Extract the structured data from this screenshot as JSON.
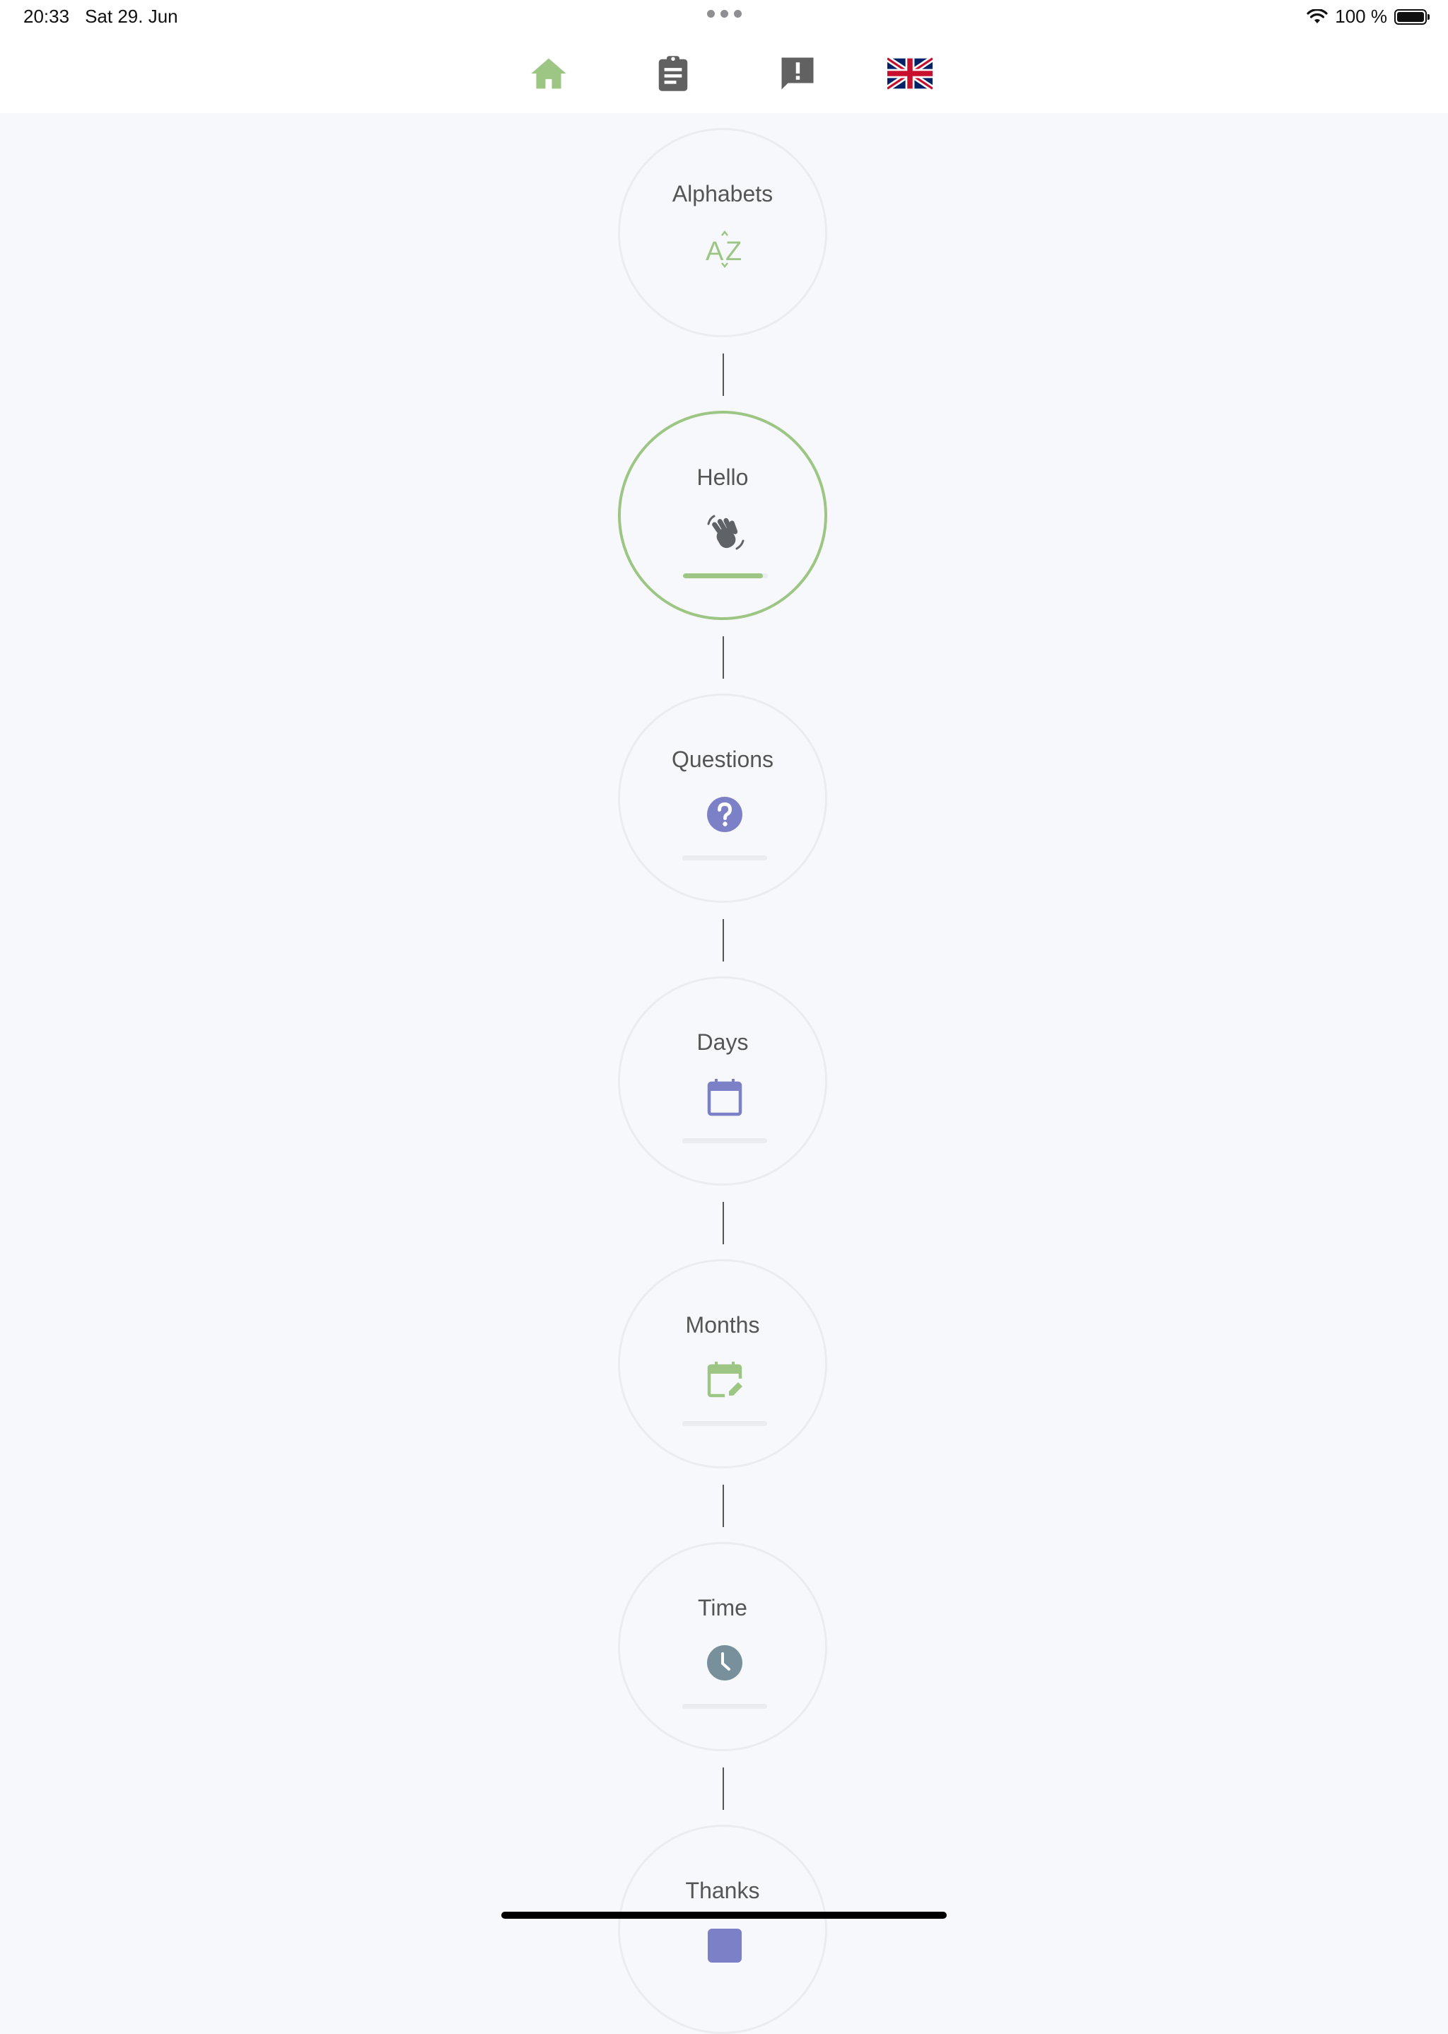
{
  "status_bar": {
    "time": "20:33",
    "date": "Sat 29. Jun",
    "battery": "100 %",
    "battery_level": 1.0
  },
  "nav": {
    "items": [
      {
        "id": "home",
        "icon": "home-icon",
        "active": true
      },
      {
        "id": "lessons",
        "icon": "clipboard-icon",
        "active": false
      },
      {
        "id": "feedback",
        "icon": "feedback-icon",
        "active": false
      },
      {
        "id": "language",
        "icon": "uk-flag-icon",
        "active": false
      }
    ]
  },
  "colors": {
    "accent_green": "#9dc584",
    "icon_blue": "#7c80c6",
    "icon_gray": "#5f6368",
    "clock_gray": "#78909c",
    "node_border": "#ebecef"
  },
  "path": {
    "nodes": [
      {
        "label": "Alphabets",
        "icon": "sort-alpha-icon",
        "progress": null,
        "active": false
      },
      {
        "label": "Hello",
        "icon": "waving-hand-icon",
        "progress": 0.94,
        "active": true
      },
      {
        "label": "Questions",
        "icon": "help-circle-icon",
        "progress": 0,
        "active": false
      },
      {
        "label": "Days",
        "icon": "calendar-icon",
        "progress": 0,
        "active": false
      },
      {
        "label": "Months",
        "icon": "calendar-edit-icon",
        "progress": 0,
        "active": false
      },
      {
        "label": "Time",
        "icon": "clock-icon",
        "progress": 0,
        "active": false
      },
      {
        "label": "Thanks",
        "icon": "thanks-icon",
        "progress": null,
        "active": false
      }
    ]
  }
}
